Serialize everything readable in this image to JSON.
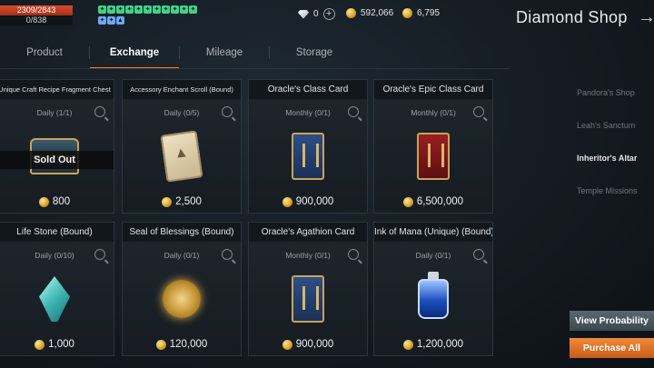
{
  "status": {
    "hp": "2309/2843",
    "mp": "0/838"
  },
  "currencies": {
    "diamonds": "0",
    "gold1": "592,066",
    "gold2": "6,795"
  },
  "window_title": "Diamond Shop",
  "tabs": [
    {
      "label": "Product"
    },
    {
      "label": "Exchange"
    },
    {
      "label": "Mileage"
    },
    {
      "label": "Storage"
    }
  ],
  "items": [
    {
      "name": "Unique Craft Recipe Fragment Chest",
      "limit": "Daily (1/1)",
      "price": "800",
      "sold_out": "Sold Out",
      "icon": "chest-icon"
    },
    {
      "name": "Accessory Enchant Scroll (Bound)",
      "limit": "Daily (0/5)",
      "price": "2,500",
      "icon": "scroll-icon"
    },
    {
      "name": "Oracle's Class Card",
      "limit": "Monthly (0/1)",
      "price": "900,000",
      "icon": "class-card-icon"
    },
    {
      "name": "Oracle's Epic Class Card",
      "limit": "Monthly (0/1)",
      "price": "6,500,000",
      "icon": "epic-class-card-icon"
    },
    {
      "name": "Life Stone (Bound)",
      "limit": "Daily (0/10)",
      "price": "1,000",
      "icon": "life-stone-icon"
    },
    {
      "name": "Seal of Blessings (Bound)",
      "limit": "Daily (0/1)",
      "price": "120,000",
      "icon": "seal-icon"
    },
    {
      "name": "Oracle's Agathion Card",
      "limit": "Monthly (0/1)",
      "price": "900,000",
      "icon": "agathion-card-icon"
    },
    {
      "name": "Ink of Mana (Unique) (Bound)",
      "limit": "Daily (0/1)",
      "price": "1,200,000",
      "icon": "ink-icon"
    }
  ],
  "side_menu": [
    {
      "label": "Pandora's Shop"
    },
    {
      "label": "Leah's Sanctum"
    },
    {
      "label": "Inheritor's Altar"
    },
    {
      "label": "Temple Missions"
    }
  ],
  "buttons": {
    "view_probability": "View Probability",
    "purchase_all": "Purchase All"
  },
  "colors": {
    "accent": "#ff7a2a",
    "hp": "#d84a2c"
  }
}
